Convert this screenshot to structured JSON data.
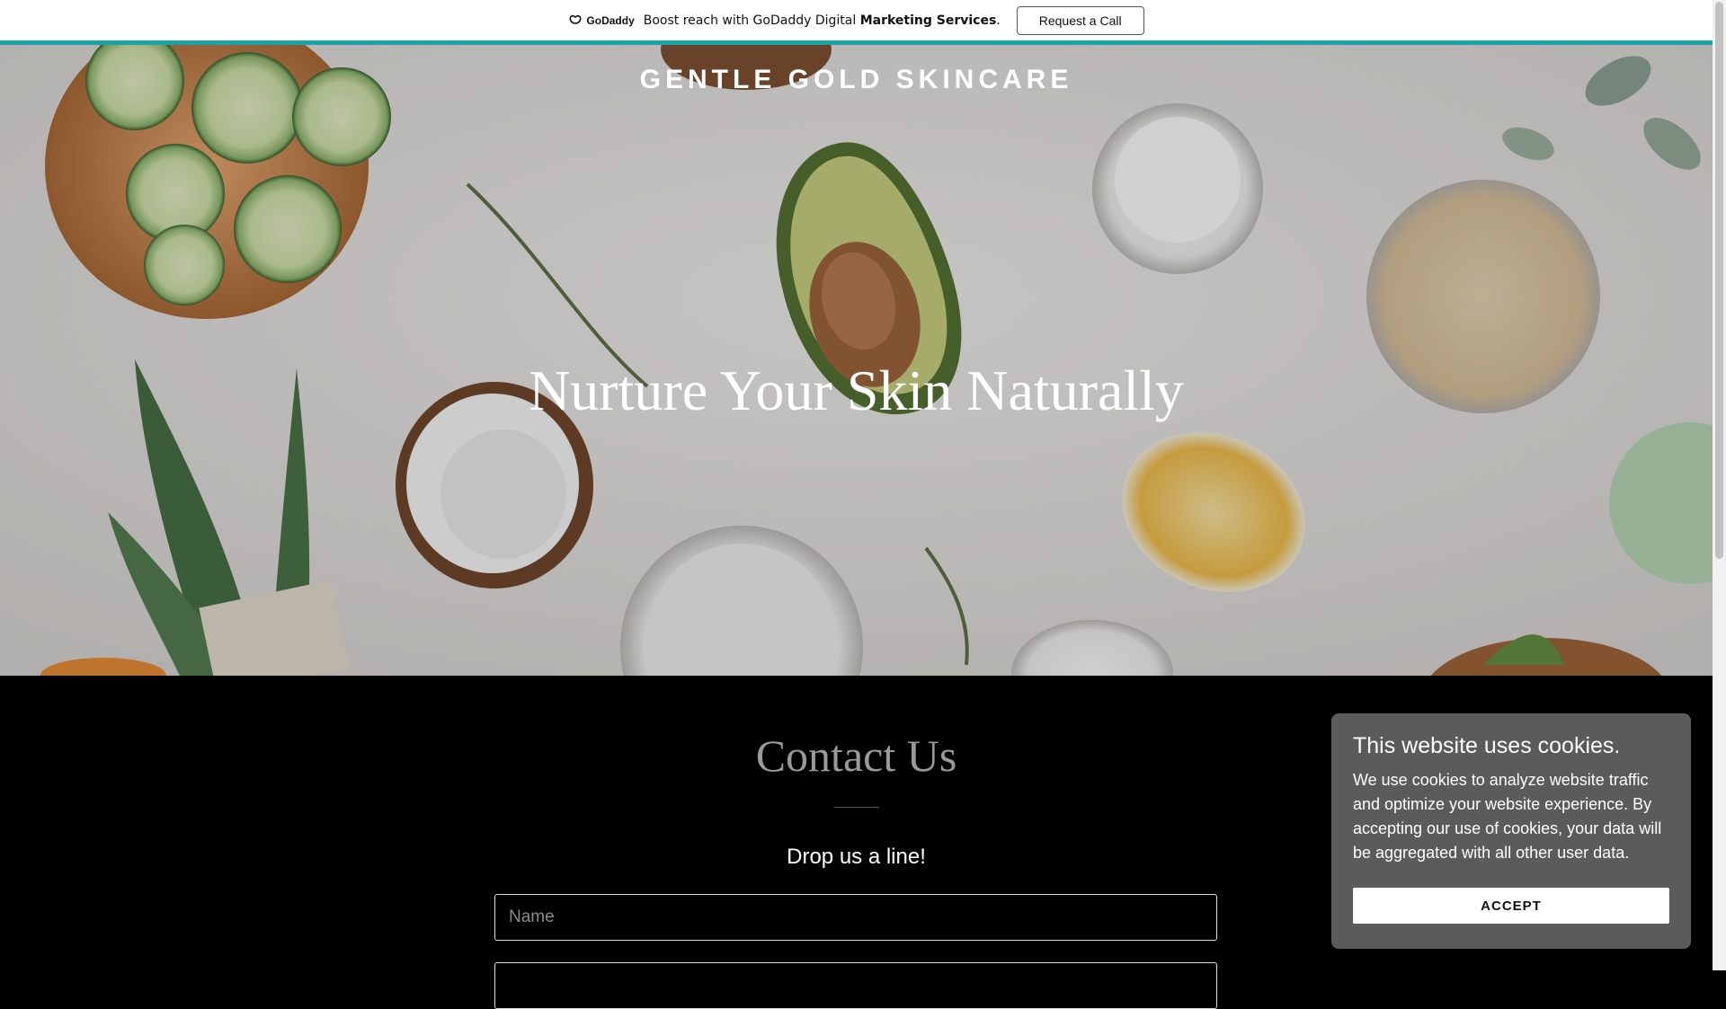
{
  "promo": {
    "logo_text": "GoDaddy",
    "text_prefix": "Boost reach with GoDaddy Digital ",
    "text_bold": "Marketing Services",
    "text_suffix": ".",
    "button_label": "Request a Call"
  },
  "hero": {
    "brand": "GENTLE GOLD SKINCARE",
    "heading": "Nurture Your Skin Naturally"
  },
  "contact": {
    "title": "Contact Us",
    "subtitle": "Drop us a line!",
    "name_placeholder": "Name",
    "email_placeholder": ""
  },
  "cookies": {
    "title": "This website uses cookies.",
    "body": "We use cookies to analyze website traffic and optimize your website experience. By accepting our use of cookies, your data will be aggregated with all other user data.",
    "accept_label": "ACCEPT"
  },
  "colors": {
    "accent_teal": "#1ba3a9",
    "contact_bg": "#000000",
    "cookie_bg": "#5b5b5b"
  }
}
